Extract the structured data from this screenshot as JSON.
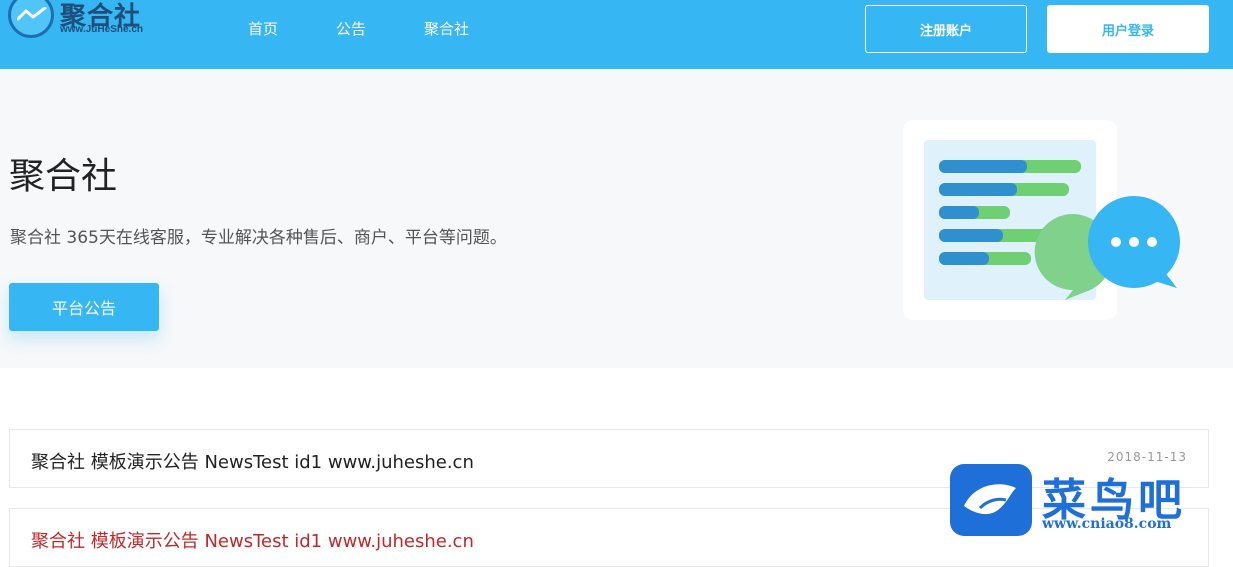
{
  "header": {
    "logo_text": "聚合社",
    "logo_sub": "www.JuHeShe.cn",
    "nav": [
      "首页",
      "公告",
      "聚合社"
    ],
    "register_label": "注册账户",
    "login_label": "用户登录",
    "accent_color": "#36b6f2"
  },
  "hero": {
    "title": "聚合社",
    "description": "聚合社 365天在线客服，专业解决各种售后、商户、平台等问题。",
    "button_label": "平台公告"
  },
  "news": [
    {
      "title": "聚合社 模板演示公告 NewsTest id1 www.juheshe.cn",
      "date": "2018-11-13"
    },
    {
      "title": "聚合社 模板演示公告 NewsTest id1 www.juheshe.cn",
      "date": ""
    }
  ],
  "watermark": {
    "text": "菜鸟吧",
    "url": "www.cniao8.com"
  }
}
